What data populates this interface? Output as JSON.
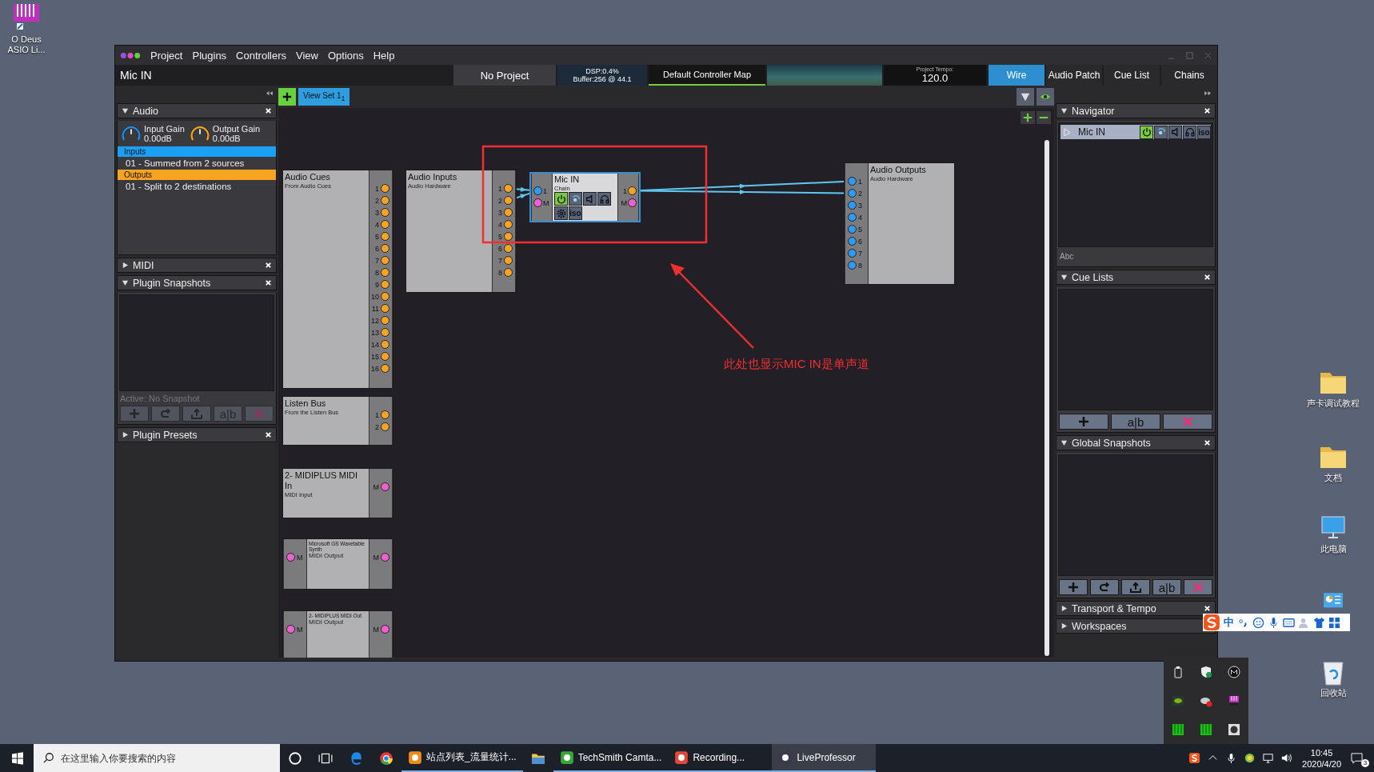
{
  "desktop": {
    "icons": [
      {
        "label": "O Deus ASIO Li...",
        "kind": "app"
      },
      {
        "label": "声卡调试教程",
        "kind": "folder"
      },
      {
        "label": "文档",
        "kind": "folder"
      },
      {
        "label": "此电脑",
        "kind": "computer"
      },
      {
        "kind": "control-panel"
      },
      {
        "label": "回收站",
        "kind": "recycle-bin"
      }
    ]
  },
  "window": {
    "menu": [
      "Project",
      "Plugins",
      "Controllers",
      "View",
      "Options",
      "Help"
    ],
    "title": "Mic IN",
    "project": "No Project",
    "dsp": "DSP:0.4%",
    "buffer": "Buffer:256 @ 44.1",
    "controller_map": "Default Controller Map",
    "tempo_label": "Project Tempo:",
    "tempo": "120.0",
    "tabs": [
      {
        "label": "Wire",
        "selected": true
      },
      {
        "label": "Audio Patch",
        "selected": false
      },
      {
        "label": "Cue List",
        "selected": false
      },
      {
        "label": "Chains",
        "selected": false
      }
    ]
  },
  "left_panels": [
    {
      "kind": "audio",
      "title": "Audio",
      "expanded": true,
      "knobs": [
        {
          "label": "Input Gain",
          "value": "0.00dB",
          "color": "#1e8fe0"
        },
        {
          "label": "Output Gain",
          "value": "0.00dB",
          "color": "#f0a020"
        }
      ],
      "groups": [
        {
          "title": "Inputs",
          "color": "#1aa0f5",
          "items": [
            "01 - Summed from 2 sources"
          ]
        },
        {
          "title": "Outputs",
          "color": "#f8a420",
          "items": [
            "01 - Split to 2 destinations"
          ]
        }
      ]
    },
    {
      "title": "MIDI",
      "expanded": false
    },
    {
      "kind": "snapshots",
      "title": "Plugin Snapshots",
      "expanded": true,
      "status": "Active: No Snapshot",
      "buttons": [
        {
          "kind": "add",
          "disabled": true
        },
        {
          "kind": "redo",
          "disabled": true
        },
        {
          "kind": "export",
          "disabled": true
        },
        {
          "kind": "rename",
          "label": "a|b",
          "disabled": true
        },
        {
          "kind": "delete",
          "disabled": true
        }
      ]
    },
    {
      "title": "Plugin Presets",
      "expanded": false
    }
  ],
  "canvas": {
    "view_sets": [
      {
        "label": "View Set 1$_{1}$",
        "selected": true
      }
    ],
    "nodes": [
      {
        "kind": "io",
        "title": "Audio Cues",
        "subtitle": "From Audio Cues",
        "selected": false,
        "outputs": [
          {
            "kind": "audio",
            "labels": [
              "1",
              "2",
              "3",
              "4",
              "5",
              "6",
              "7",
              "8",
              "9",
              "10",
              "11",
              "12",
              "13",
              "14",
              "15",
              "16"
            ]
          }
        ]
      },
      {
        "kind": "io",
        "title": "Listen Bus",
        "subtitle": "From the Listen Bus",
        "selected": false,
        "outputs": [
          {
            "kind": "audio",
            "labels": [
              "1",
              "2"
            ]
          }
        ]
      },
      {
        "kind": "io",
        "title": "2- MIDIPLUS MIDI In",
        "subtitle": "MIDI Input",
        "selected": false,
        "outputs": [
          {
            "kind": "midi",
            "labels": [
              "M"
            ]
          }
        ]
      },
      {
        "kind": "midi-port",
        "title": "Microsoft GS Wavetable Synth",
        "subtitle": "MIDI Output",
        "selected": false,
        "inputs": [
          {
            "kind": "midi",
            "labels": [
              "M"
            ]
          }
        ],
        "outputs": [
          {
            "kind": "midi",
            "labels": [
              "M"
            ]
          }
        ]
      },
      {
        "kind": "midi-port",
        "title": "2- MIDIPLUS MIDI Out",
        "subtitle": "MIDI Output",
        "selected": false,
        "inputs": [
          {
            "kind": "midi",
            "labels": [
              "M"
            ]
          }
        ],
        "outputs": [
          {
            "kind": "midi",
            "labels": [
              "M"
            ]
          }
        ]
      },
      {
        "kind": "io",
        "title": "Audio Inputs",
        "subtitle": "Audio Hardware",
        "selected": false,
        "outputs": [
          {
            "kind": "audio",
            "labels": [
              "1",
              "2",
              "3",
              "4",
              "5",
              "6",
              "7",
              "8"
            ]
          }
        ]
      },
      {
        "kind": "plugin",
        "title": "Mic IN",
        "subtitle": "Chain",
        "selected": true,
        "inputs": [
          {
            "kind": "audio",
            "labels": [
              "1"
            ]
          },
          {
            "kind": "midi",
            "labels": [
              "M"
            ]
          }
        ],
        "outputs": [
          {
            "kind": "audio",
            "labels": [
              "1"
            ]
          },
          {
            "kind": "midi",
            "labels": [
              "M"
            ]
          }
        ],
        "controls": [
          {
            "kind": "power",
            "on": true
          },
          {
            "kind": "swirl",
            "on": false
          },
          {
            "kind": "speaker",
            "on": false
          },
          {
            "kind": "headphones",
            "on": false
          },
          {
            "kind": "settings",
            "on": false
          },
          {
            "kind": "iso",
            "label": "iso",
            "on": false
          }
        ]
      },
      {
        "kind": "io",
        "title": "Audio Outputs",
        "subtitle": "Audio Hardware",
        "selected": false,
        "inputs": [
          {
            "kind": "audio",
            "labels": [
              "1",
              "2",
              "3",
              "4",
              "5",
              "6",
              "7",
              "8"
            ]
          }
        ]
      }
    ],
    "annotation": "此处也显示MIC IN是单声道"
  },
  "right_panels": [
    {
      "kind": "navigator",
      "title": "Navigator",
      "expanded": true,
      "rows": [
        {
          "label": "Mic IN",
          "controls": [
            {
              "kind": "power",
              "on": true
            },
            {
              "kind": "swirl",
              "on": false
            },
            {
              "kind": "speaker",
              "on": false
            },
            {
              "kind": "headphones",
              "on": false
            },
            {
              "kind": "iso",
              "label": "iso",
              "on": false
            }
          ]
        }
      ],
      "placeholder": "Abc"
    },
    {
      "kind": "snapshots",
      "title": "Cue Lists",
      "expanded": true,
      "buttons": [
        {
          "kind": "add",
          "disabled": false
        },
        {
          "kind": "rename",
          "label": "a|b",
          "disabled": false
        },
        {
          "kind": "delete",
          "disabled": false
        }
      ]
    },
    {
      "kind": "snapshots",
      "title": "Global Snapshots",
      "expanded": true,
      "buttons": [
        {
          "kind": "add",
          "disabled": false
        },
        {
          "kind": "redo",
          "disabled": false
        },
        {
          "kind": "export",
          "disabled": false
        },
        {
          "kind": "rename",
          "label": "a|b",
          "disabled": false
        },
        {
          "kind": "delete",
          "disabled": false
        }
      ]
    },
    {
      "title": "Transport & Tempo",
      "expanded": false
    },
    {
      "title": "Workspaces",
      "expanded": false
    }
  ],
  "ime_bar": {
    "mode": "中"
  },
  "taskbar": {
    "search_placeholder": "在这里输入你要搜索的内容",
    "apps": [
      {
        "kind": "cortana"
      },
      {
        "kind": "task-view"
      },
      {
        "kind": "edge"
      },
      {
        "kind": "chrome"
      },
      {
        "kind": "web-app",
        "label": "站点列表_流量统计..."
      },
      {
        "kind": "explorer"
      },
      {
        "kind": "camtasia",
        "label": "TechSmith Camta..."
      },
      {
        "kind": "recorder",
        "label": "Recording..."
      },
      {
        "kind": "liveprofessor",
        "label": "LiveProfessor"
      }
    ],
    "time": "10:45",
    "date": "2020/4/20",
    "notifications": "3"
  }
}
